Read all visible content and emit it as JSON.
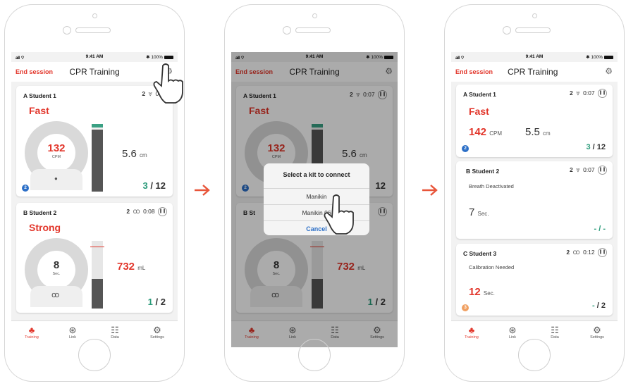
{
  "status_bar": {
    "signal": "all ⌔",
    "time": "9:41 AM",
    "battery": "✱ 100%"
  },
  "nav": {
    "end_session": "End session",
    "title": "CPR Training"
  },
  "tabs": [
    {
      "label": "Training",
      "icon": "cpr-training-icon"
    },
    {
      "label": "Link",
      "icon": "link-kit-icon"
    },
    {
      "label": "Data",
      "icon": "data-group-icon"
    },
    {
      "label": "Settings",
      "icon": "gear-icon"
    }
  ],
  "screen1": {
    "card_a": {
      "name": "A Student 1",
      "count": "2",
      "time": "0:07",
      "status": "Fast",
      "rate": "132",
      "rate_unit": "CPM",
      "depth": "5.6",
      "depth_unit": "cm",
      "score_current": "3",
      "score_total": "/ 12",
      "badge": "2"
    },
    "card_b": {
      "name": "B Student 2",
      "count": "2",
      "time": "0:08",
      "status": "Strong",
      "seconds": "8",
      "seconds_unit": "Sec.",
      "volume": "732",
      "volume_unit": "mL",
      "score_current": "1",
      "score_total": "/ 2"
    }
  },
  "screen2": {
    "card_a": {
      "name": "A Student 1",
      "count": "2",
      "time": "0:07",
      "status": "Fast",
      "rate": "132",
      "rate_unit": "CPM",
      "depth": "5.6",
      "depth_unit": "cm",
      "score_partial": "12",
      "badge": "2"
    },
    "card_b": {
      "name": "B St",
      "seconds": "8",
      "seconds_unit": "Sec.",
      "volume": "732",
      "volume_unit": "mL",
      "score_current": "1",
      "score_total": "/ 2"
    },
    "dialog": {
      "title": "Select a kit to connect",
      "option1": "Manikin",
      "option2": "Manikin 06",
      "cancel": "Cancel"
    }
  },
  "screen3": {
    "card_a": {
      "name": "A Student 1",
      "count": "2",
      "time": "0:07",
      "status": "Fast",
      "rate": "142",
      "rate_unit": "CPM",
      "depth": "5.5",
      "depth_unit": "cm",
      "score_current": "3",
      "score_total": "/ 12",
      "badge": "2"
    },
    "card_b": {
      "name": "B Student 2",
      "count": "2",
      "time": "0:07",
      "status": "Breath Deactivated",
      "seconds": "7",
      "seconds_unit": "Sec.",
      "score": "- / -"
    },
    "card_c": {
      "name": "C Student 3",
      "count": "2",
      "time": "0:12",
      "status": "Calibration Needed",
      "seconds": "12",
      "seconds_unit": "Sec.",
      "score_current": "-",
      "score_total": "/ 2",
      "badge": "3"
    }
  },
  "colors": {
    "accent_red": "#e2362b",
    "good_green": "#2b9b7a",
    "badge_blue": "#2c6fc7",
    "badge_orange": "#f0a062"
  }
}
